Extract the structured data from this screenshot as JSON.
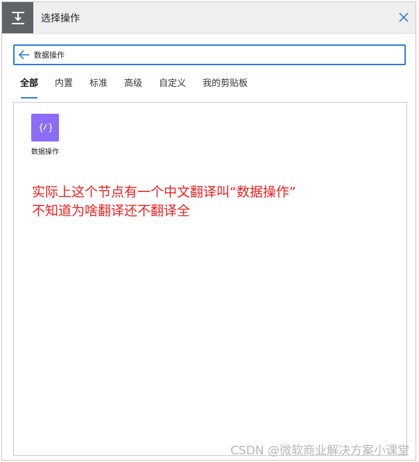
{
  "header": {
    "title": "选择操作",
    "icon": "download-tray-icon",
    "close_icon": "close-icon"
  },
  "search": {
    "value": "数据操作",
    "back_icon": "back-arrow-icon"
  },
  "tabs": [
    {
      "label": "全部",
      "active": true
    },
    {
      "label": "内置",
      "active": false
    },
    {
      "label": "标准",
      "active": false
    },
    {
      "label": "高级",
      "active": false
    },
    {
      "label": "自定义",
      "active": false
    },
    {
      "label": "我的剪贴板",
      "active": false
    }
  ],
  "results": [
    {
      "label": "数据操作",
      "icon": "data-operation-icon",
      "icon_color": "#8c6cf7"
    }
  ],
  "annotation": {
    "line1": "实际上这个节点有一个中文翻译叫“数据操作”",
    "line2": "不知道为啥翻译还不翻译全"
  },
  "watermark": "CSDN @微软商业解决方案小课堂",
  "colors": {
    "accent": "#2b7cd3",
    "header_bg": "#efefef",
    "header_icon_bg": "#5f6368",
    "annotation": "#f11e1e"
  }
}
